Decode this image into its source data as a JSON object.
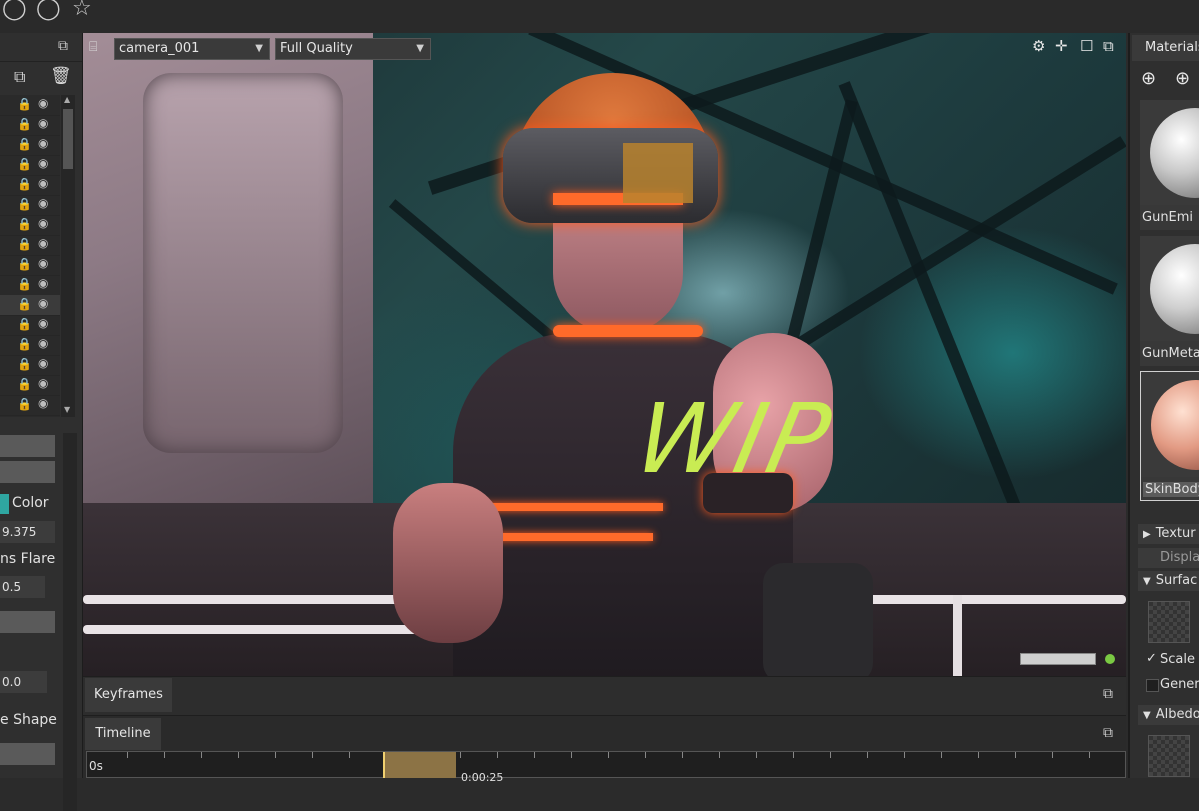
{
  "icons": {
    "topbar": [
      "lasso-icon",
      "circle-select-icon",
      "brush-select-icon"
    ],
    "left_header": "popout-icon",
    "left_tools": [
      "add-object-icon",
      "delete-icon"
    ],
    "viewport_right": [
      "gear-icon",
      "move-icon",
      "maximize-icon",
      "popout-icon"
    ]
  },
  "viewport": {
    "camera_select": "camera_001",
    "quality_select": "Full Quality",
    "watermark": "WIP"
  },
  "left_panel": {
    "outliner_rows": 16,
    "props": {
      "color_label": "Color",
      "value1": "9.375",
      "lens_flare_label": "ns Flare",
      "value2": "0.5",
      "value3": "0.0",
      "shape_label": "e Shape"
    }
  },
  "bottom": {
    "keyframes_tab": "Keyframes",
    "timeline_tab": "Timeline",
    "ruler_start": "0s",
    "ruler_mark": "0:00:25"
  },
  "materials": {
    "tab_label": "Materials",
    "items": [
      {
        "name": "GunEmi"
      },
      {
        "name": "GunMeta"
      },
      {
        "name": "SkinBody"
      }
    ],
    "sections": {
      "textures": "Textur",
      "displacement": "Displac",
      "surface": "Surfac",
      "scale": "Scale a",
      "generate": "Gener",
      "albedo": "Albedo"
    }
  },
  "colors": {
    "accent_teal": "#2fa6a1",
    "wip_green": "#c9ec53",
    "status_green": "#7ac943"
  }
}
